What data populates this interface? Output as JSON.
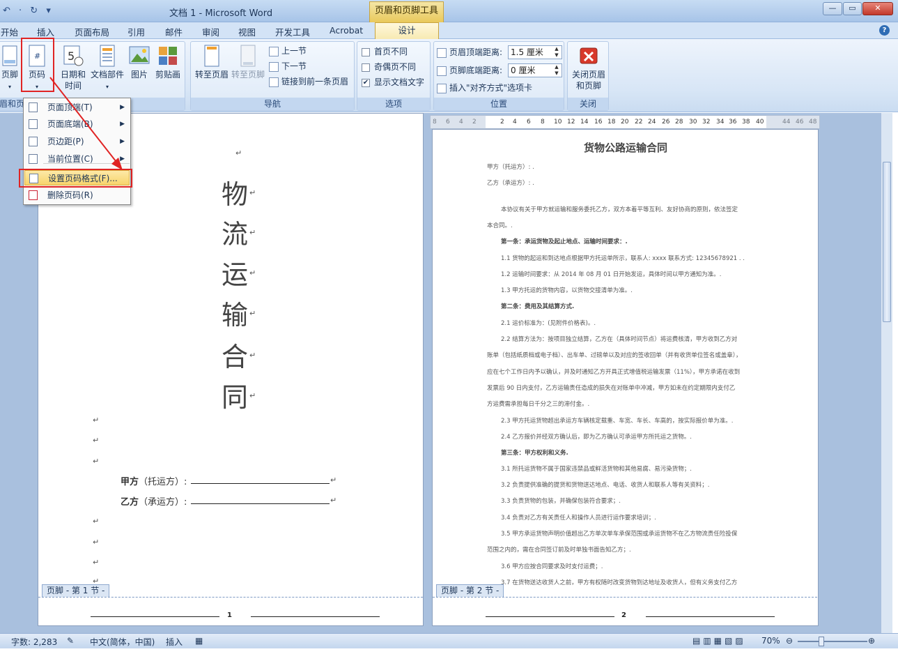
{
  "window": {
    "title": "文档 1 - Microsoft Word",
    "tool_tab": "页眉和页脚工具",
    "quick_access": "↶ · ↻ ▾",
    "minimize": "—",
    "restore": "▭",
    "close": "✕"
  },
  "tabs": [
    "开始",
    "插入",
    "页面布局",
    "引用",
    "邮件",
    "审阅",
    "视图",
    "开发工具",
    "Acrobat"
  ],
  "active_tab": "设计",
  "ribbon": {
    "footer_btn": "页脚",
    "page_number_btn": "页码",
    "group_hf_label": "眉和页脚",
    "date_time_btn": [
      "日期和",
      "时间"
    ],
    "doc_parts_btn": "文档部件",
    "picture_btn": "图片",
    "clipart_btn": "剪贴画",
    "goto_header_btn": "转至页眉",
    "goto_footer_btn": "转至页脚",
    "prev_section": "上一节",
    "next_section": "下一节",
    "link_prev": "链接到前一条页眉",
    "nav_label": "导航",
    "diff_first": "首页不同",
    "diff_odd_even": "奇偶页不同",
    "show_doc_text": "显示文档文字",
    "options_label": "选项",
    "header_from_top": "页眉顶端距离:",
    "header_from_top_value": "1.5 厘米",
    "footer_from_bottom": "页脚底端距离:",
    "footer_from_bottom_value": "0 厘米",
    "insert_align_tab": "插入\"对齐方式\"选项卡",
    "position_label": "位置",
    "close_hf_btn": [
      "关闭页眉",
      "和页脚"
    ],
    "close_label": "关闭"
  },
  "page_number_menu": {
    "items": [
      {
        "label": "页面顶端(T)",
        "has_submenu": true
      },
      {
        "label": "页面底端(B)",
        "has_submenu": true
      },
      {
        "label": "页边距(P)",
        "has_submenu": true
      },
      {
        "label": "当前位置(C)",
        "has_submenu": true
      },
      {
        "label": "设置页码格式(F)...",
        "has_submenu": false,
        "highlighted": true
      },
      {
        "label": "删除页码(R)",
        "has_submenu": false
      }
    ]
  },
  "ruler_ticks": [
    "8",
    "6",
    "4",
    "2",
    "2",
    "4",
    "6",
    "8",
    "10",
    "12",
    "14",
    "16",
    "18",
    "20",
    "22",
    "24",
    "26",
    "28",
    "30",
    "32",
    "34",
    "36",
    "38",
    "40",
    "44",
    "46",
    "48"
  ],
  "page1": {
    "cover_chars": [
      "物",
      "流",
      "运",
      "输",
      "合",
      "同"
    ],
    "party_a_label": "甲方",
    "party_a_note": "（托运方）:",
    "party_b_label": "乙方",
    "party_b_note": "（承运方）:",
    "footer_tag": "页脚 - 第 1 节 -",
    "page_number": "1"
  },
  "page2": {
    "title": "货物公路运输合同",
    "lines": [
      {
        "text": "甲方（托运方）: .",
        "bold": false
      },
      {
        "text": "乙方（承运方）: .",
        "bold": false
      },
      {
        "text": "本协议有关于甲方就运输和服务委托乙方，双方本着平等互利、友好协商的原则，依法签定",
        "bold": false
      },
      {
        "text": "本合同。.",
        "bold": false
      },
      {
        "text": "第一条：承运货物及起止地点、运输时间要求：.",
        "bold": true
      },
      {
        "text": "1.1 货物的起运和到达地点根据甲方托运单所示，联系人: xxxx 联系方式: 12345678921 . .",
        "bold": false
      },
      {
        "text": "1.2 运输时间要求：从 2014 年 08 月 01 日开始发运，具体时间以甲方通知为准。.",
        "bold": false
      },
      {
        "text": "1.3 甲方托运的货物内容，以货物交接清单为准。.",
        "bold": false
      },
      {
        "text": "第二条：费用及其结算方式.",
        "bold": true
      },
      {
        "text": "2.1 运价标准为：(见附件价格表)。.",
        "bold": false
      },
      {
        "text": "2.2 结算方法为：按项目独立结算，乙方在（具体时间节点）将运费核清，甲方收到乙方对",
        "bold": false
      },
      {
        "text": "账单（包括纸质档或电子档）、出车单、过磅单以及对应的签收回单（并有收货单位签名或盖章），",
        "bold": false
      },
      {
        "text": "应在七个工作日内予以确认，并及时通知乙方开具正式增值税运输发票（11%），甲方承诺在收到",
        "bold": false
      },
      {
        "text": "发票后 90 日内支付，乙方运输责任造成的损失在对账单中冲减，甲方如未在约定期限内支付乙",
        "bold": false
      },
      {
        "text": "方运费需承担每日千分之三的滞付金。.",
        "bold": false
      },
      {
        "text": "2.3 甲方托运货物超出承运方车辆核定载重、车宽、车长、车高的，按实际报价单为准。.",
        "bold": false
      },
      {
        "text": "2.4 乙方报价并经双方确认后，即为乙方确认可承运甲方所托运之货物。.",
        "bold": false
      },
      {
        "text": "第三条：甲方权利和义务.",
        "bold": true
      },
      {
        "text": "3.1 所托运货物不属于国家违禁品或鲜活货物和其他易腐、易污染货物；.",
        "bold": false
      },
      {
        "text": "3.2 负责提供准确的提货和货物送达地点、电话、收货人和联系人等有关资料；.",
        "bold": false
      },
      {
        "text": "3.3 负责货物的包装，并确保包装符合要求；.",
        "bold": false
      },
      {
        "text": "3.4 负责对乙方有关责任人和操作人员进行运作要求培训；.",
        "bold": false
      },
      {
        "text": "3.5 甲方承运货物声明价值超出乙方单次单车承保范围或承运货物不在乙方物流责任险投保",
        "bold": false
      },
      {
        "text": "范围之内的，需在合同签订前及时单独书面告知乙方；.",
        "bold": false
      },
      {
        "text": "3.6 甲方应按合同要求及时支付运费；.",
        "bold": false
      },
      {
        "text": "3.7 在货物送达收货人之前，甲方有权随时改变货物到达地址及收货人，但有义务支付乙方",
        "bold": false
      }
    ],
    "footer_tag": "页脚 - 第 2 节 -",
    "page_number": "2"
  },
  "status": {
    "word_count": "字数: 2,283",
    "language": "中文(简体，中国)",
    "insert_mode": "插入",
    "zoom": "70%"
  }
}
